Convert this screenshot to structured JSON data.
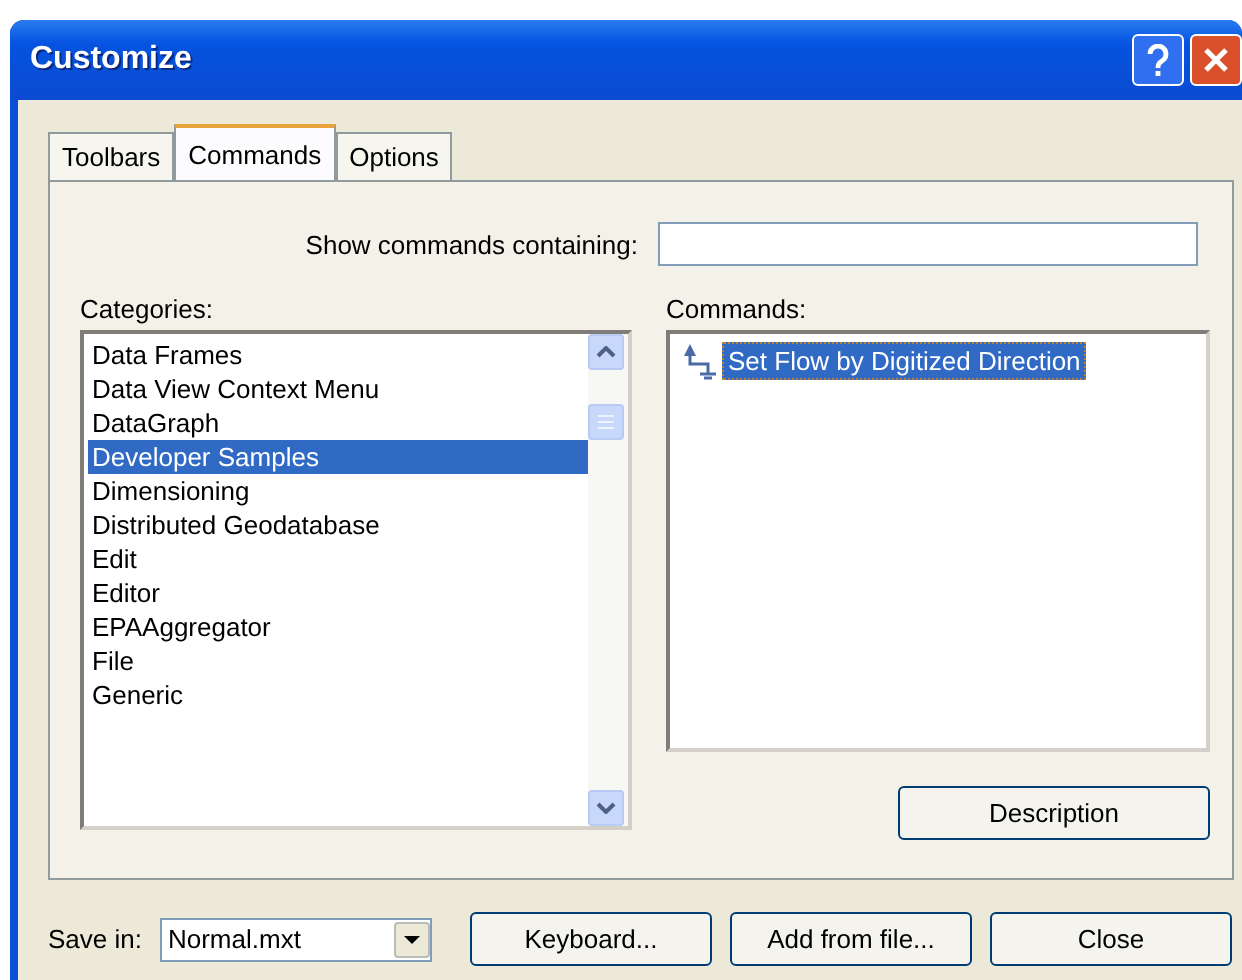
{
  "window": {
    "title": "Customize"
  },
  "tabs": [
    {
      "label": "Toolbars",
      "selected": false
    },
    {
      "label": "Commands",
      "selected": true
    },
    {
      "label": "Options",
      "selected": false
    }
  ],
  "search": {
    "label": "Show commands containing:"
  },
  "categories": {
    "label": "Categories:",
    "items": [
      {
        "label": "Data Frames",
        "selected": false
      },
      {
        "label": "Data View Context Menu",
        "selected": false
      },
      {
        "label": "DataGraph",
        "selected": false
      },
      {
        "label": "Developer Samples",
        "selected": true
      },
      {
        "label": "Dimensioning",
        "selected": false
      },
      {
        "label": "Distributed Geodatabase",
        "selected": false
      },
      {
        "label": "Edit",
        "selected": false
      },
      {
        "label": "Editor",
        "selected": false
      },
      {
        "label": "EPAAggregator",
        "selected": false
      },
      {
        "label": "File",
        "selected": false
      },
      {
        "label": "Generic",
        "selected": false
      }
    ]
  },
  "commands": {
    "label": "Commands:",
    "items": [
      {
        "label": "Set Flow by Digitized Direction",
        "selected": true
      }
    ]
  },
  "description_button": "Description",
  "save_in": {
    "label": "Save in:",
    "value": "Normal.mxt"
  },
  "buttons": [
    "Keyboard...",
    "Add from file...",
    "Close"
  ]
}
